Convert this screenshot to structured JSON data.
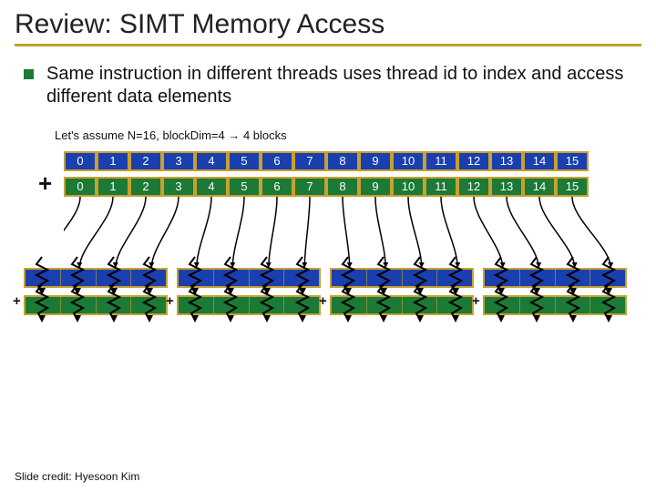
{
  "title": "Review: SIMT Memory Access",
  "bullet": "Same instruction in different threads uses thread id to index and access different data elements",
  "assume": "Let's assume N=16, blockDim=4 → 4 blocks",
  "big_plus": "+",
  "row1": [
    "0",
    "1",
    "2",
    "3",
    "4",
    "5",
    "6",
    "7",
    "8",
    "9",
    "10",
    "11",
    "12",
    "13",
    "14",
    "15"
  ],
  "row2": [
    "0",
    "1",
    "2",
    "3",
    "4",
    "5",
    "6",
    "7",
    "8",
    "9",
    "10",
    "11",
    "12",
    "13",
    "14",
    "15"
  ],
  "blocks": [
    {
      "plus": "+"
    },
    {
      "plus": "+"
    },
    {
      "plus": "+"
    },
    {
      "plus": "+"
    }
  ],
  "footer": "Slide credit: Hyesoon Kim",
  "colors": {
    "accent": "#c0a030",
    "blue": "#1a3fae",
    "green": "#1a7a36"
  }
}
